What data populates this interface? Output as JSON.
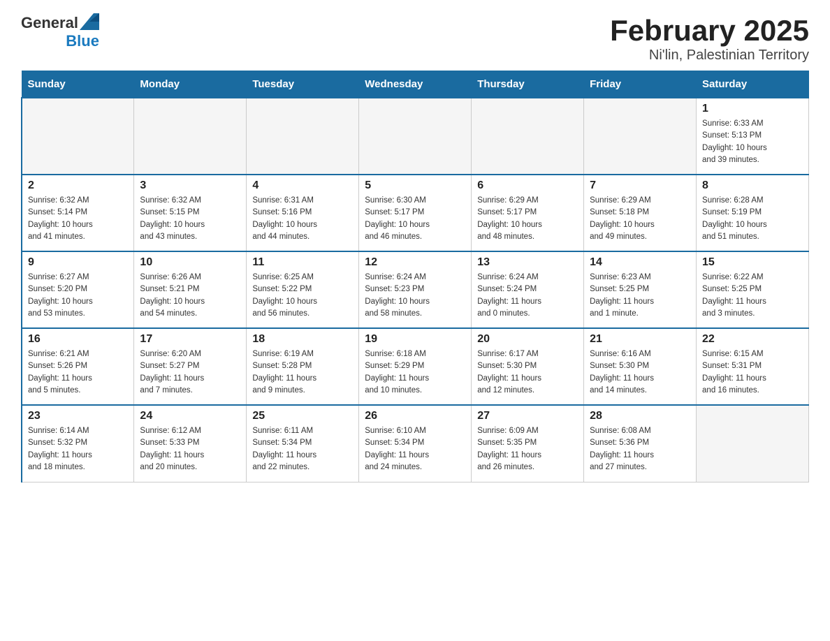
{
  "header": {
    "logo_general": "General",
    "logo_blue": "Blue",
    "month": "February 2025",
    "location": "Ni'lin, Palestinian Territory"
  },
  "days_of_week": [
    "Sunday",
    "Monday",
    "Tuesday",
    "Wednesday",
    "Thursday",
    "Friday",
    "Saturday"
  ],
  "weeks": [
    [
      {
        "day": "",
        "info": ""
      },
      {
        "day": "",
        "info": ""
      },
      {
        "day": "",
        "info": ""
      },
      {
        "day": "",
        "info": ""
      },
      {
        "day": "",
        "info": ""
      },
      {
        "day": "",
        "info": ""
      },
      {
        "day": "1",
        "info": "Sunrise: 6:33 AM\nSunset: 5:13 PM\nDaylight: 10 hours\nand 39 minutes."
      }
    ],
    [
      {
        "day": "2",
        "info": "Sunrise: 6:32 AM\nSunset: 5:14 PM\nDaylight: 10 hours\nand 41 minutes."
      },
      {
        "day": "3",
        "info": "Sunrise: 6:32 AM\nSunset: 5:15 PM\nDaylight: 10 hours\nand 43 minutes."
      },
      {
        "day": "4",
        "info": "Sunrise: 6:31 AM\nSunset: 5:16 PM\nDaylight: 10 hours\nand 44 minutes."
      },
      {
        "day": "5",
        "info": "Sunrise: 6:30 AM\nSunset: 5:17 PM\nDaylight: 10 hours\nand 46 minutes."
      },
      {
        "day": "6",
        "info": "Sunrise: 6:29 AM\nSunset: 5:17 PM\nDaylight: 10 hours\nand 48 minutes."
      },
      {
        "day": "7",
        "info": "Sunrise: 6:29 AM\nSunset: 5:18 PM\nDaylight: 10 hours\nand 49 minutes."
      },
      {
        "day": "8",
        "info": "Sunrise: 6:28 AM\nSunset: 5:19 PM\nDaylight: 10 hours\nand 51 minutes."
      }
    ],
    [
      {
        "day": "9",
        "info": "Sunrise: 6:27 AM\nSunset: 5:20 PM\nDaylight: 10 hours\nand 53 minutes."
      },
      {
        "day": "10",
        "info": "Sunrise: 6:26 AM\nSunset: 5:21 PM\nDaylight: 10 hours\nand 54 minutes."
      },
      {
        "day": "11",
        "info": "Sunrise: 6:25 AM\nSunset: 5:22 PM\nDaylight: 10 hours\nand 56 minutes."
      },
      {
        "day": "12",
        "info": "Sunrise: 6:24 AM\nSunset: 5:23 PM\nDaylight: 10 hours\nand 58 minutes."
      },
      {
        "day": "13",
        "info": "Sunrise: 6:24 AM\nSunset: 5:24 PM\nDaylight: 11 hours\nand 0 minutes."
      },
      {
        "day": "14",
        "info": "Sunrise: 6:23 AM\nSunset: 5:25 PM\nDaylight: 11 hours\nand 1 minute."
      },
      {
        "day": "15",
        "info": "Sunrise: 6:22 AM\nSunset: 5:25 PM\nDaylight: 11 hours\nand 3 minutes."
      }
    ],
    [
      {
        "day": "16",
        "info": "Sunrise: 6:21 AM\nSunset: 5:26 PM\nDaylight: 11 hours\nand 5 minutes."
      },
      {
        "day": "17",
        "info": "Sunrise: 6:20 AM\nSunset: 5:27 PM\nDaylight: 11 hours\nand 7 minutes."
      },
      {
        "day": "18",
        "info": "Sunrise: 6:19 AM\nSunset: 5:28 PM\nDaylight: 11 hours\nand 9 minutes."
      },
      {
        "day": "19",
        "info": "Sunrise: 6:18 AM\nSunset: 5:29 PM\nDaylight: 11 hours\nand 10 minutes."
      },
      {
        "day": "20",
        "info": "Sunrise: 6:17 AM\nSunset: 5:30 PM\nDaylight: 11 hours\nand 12 minutes."
      },
      {
        "day": "21",
        "info": "Sunrise: 6:16 AM\nSunset: 5:30 PM\nDaylight: 11 hours\nand 14 minutes."
      },
      {
        "day": "22",
        "info": "Sunrise: 6:15 AM\nSunset: 5:31 PM\nDaylight: 11 hours\nand 16 minutes."
      }
    ],
    [
      {
        "day": "23",
        "info": "Sunrise: 6:14 AM\nSunset: 5:32 PM\nDaylight: 11 hours\nand 18 minutes."
      },
      {
        "day": "24",
        "info": "Sunrise: 6:12 AM\nSunset: 5:33 PM\nDaylight: 11 hours\nand 20 minutes."
      },
      {
        "day": "25",
        "info": "Sunrise: 6:11 AM\nSunset: 5:34 PM\nDaylight: 11 hours\nand 22 minutes."
      },
      {
        "day": "26",
        "info": "Sunrise: 6:10 AM\nSunset: 5:34 PM\nDaylight: 11 hours\nand 24 minutes."
      },
      {
        "day": "27",
        "info": "Sunrise: 6:09 AM\nSunset: 5:35 PM\nDaylight: 11 hours\nand 26 minutes."
      },
      {
        "day": "28",
        "info": "Sunrise: 6:08 AM\nSunset: 5:36 PM\nDaylight: 11 hours\nand 27 minutes."
      },
      {
        "day": "",
        "info": ""
      }
    ]
  ]
}
